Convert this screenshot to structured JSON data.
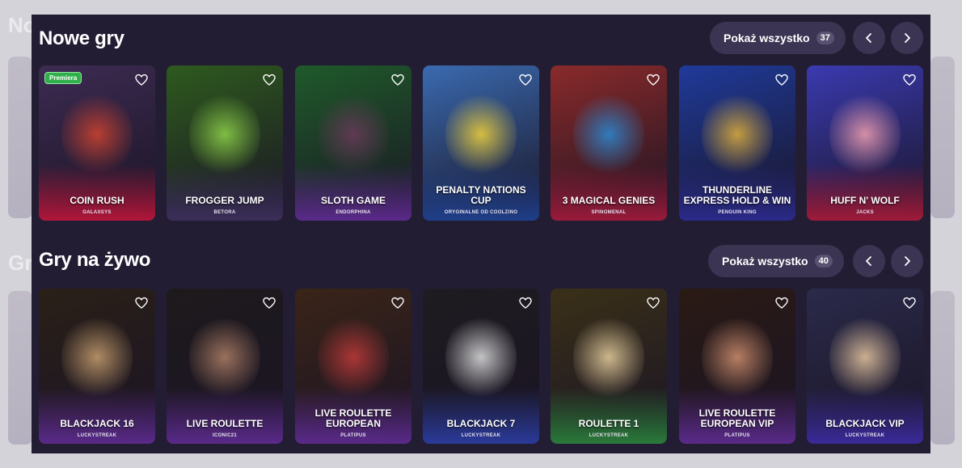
{
  "sections": [
    {
      "title": "Nowe gry",
      "show_all_label": "Pokaż wszystko",
      "count": "37",
      "games": [
        {
          "name": "COIN RUSH",
          "provider": "GALAXSYS",
          "badge": "Premiera",
          "bg": "#3d2b52",
          "glow": "#d1432f",
          "shade": "#b2163a"
        },
        {
          "name": "FROGGER JUMP",
          "provider": "BETORA",
          "bg": "#2e5a1e",
          "glow": "#8fd44a",
          "shade": "#3b2e5a"
        },
        {
          "name": "SLOTH GAME",
          "provider": "ENDORPHINA",
          "bg": "#1f5a2a",
          "glow": "#6a3a5a",
          "shade": "#5a2a8a"
        },
        {
          "name": "PENALTY NATIONS CUP",
          "provider": "ORYGINALNE OD COOLZINO",
          "bg": "#3a6ab0",
          "glow": "#f2d33a",
          "shade": "#1f3f8a"
        },
        {
          "name": "3 MAGICAL GENIES",
          "provider": "SPINOMENAL",
          "bg": "#8a2a2a",
          "glow": "#2a8ad4",
          "shade": "#9a1a3a"
        },
        {
          "name": "THUNDERLINE EXPRESS HOLD & WIN",
          "provider": "PENGUIN KING",
          "bg": "#1f3a9a",
          "glow": "#e0b03a",
          "shade": "#2a2a8a"
        },
        {
          "name": "HUFF N' WOLF",
          "provider": "JACKS",
          "bg": "#3a3ab0",
          "glow": "#f2a0b0",
          "shade": "#a01a3a"
        }
      ]
    },
    {
      "title": "Gry na żywo",
      "show_all_label": "Pokaż wszystko",
      "count": "40",
      "games": [
        {
          "name": "BLACKJACK 16",
          "provider": "LUCKYSTREAK",
          "bg": "#2a2018",
          "glow": "#c8a070",
          "shade": "#5a2a8a"
        },
        {
          "name": "LIVE ROULETTE",
          "provider": "ICONIC21",
          "bg": "#1e1a1c",
          "glow": "#b08068",
          "shade": "#5a2a8a"
        },
        {
          "name": "LIVE ROULETTE EUROPEAN",
          "provider": "PLATIPUS",
          "bg": "#3a2418",
          "glow": "#c03a3a",
          "shade": "#5a2a8a"
        },
        {
          "name": "BLACKJACK 7",
          "provider": "LUCKYSTREAK",
          "bg": "#1e1c20",
          "glow": "#e0e0e0",
          "shade": "#2a3a9a"
        },
        {
          "name": "ROULETTE 1",
          "provider": "LUCKYSTREAK",
          "bg": "#3a3018",
          "glow": "#e8d0a0",
          "shade": "#2a7a3a"
        },
        {
          "name": "LIVE ROULETTE EUROPEAN VIP",
          "provider": "PLATIPUS",
          "bg": "#2a1a14",
          "glow": "#d09070",
          "shade": "#5a2a8a"
        },
        {
          "name": "BLACKJACK VIP",
          "provider": "LUCKYSTREAK",
          "bg": "#2a2a4a",
          "glow": "#e8c8a0",
          "shade": "#3a2a9a"
        }
      ]
    }
  ],
  "backdrop_titles": [
    "No",
    "Gr"
  ],
  "colors": {
    "panel": "#231d33",
    "button": "#3b3452",
    "badge": "#2fb04a"
  }
}
